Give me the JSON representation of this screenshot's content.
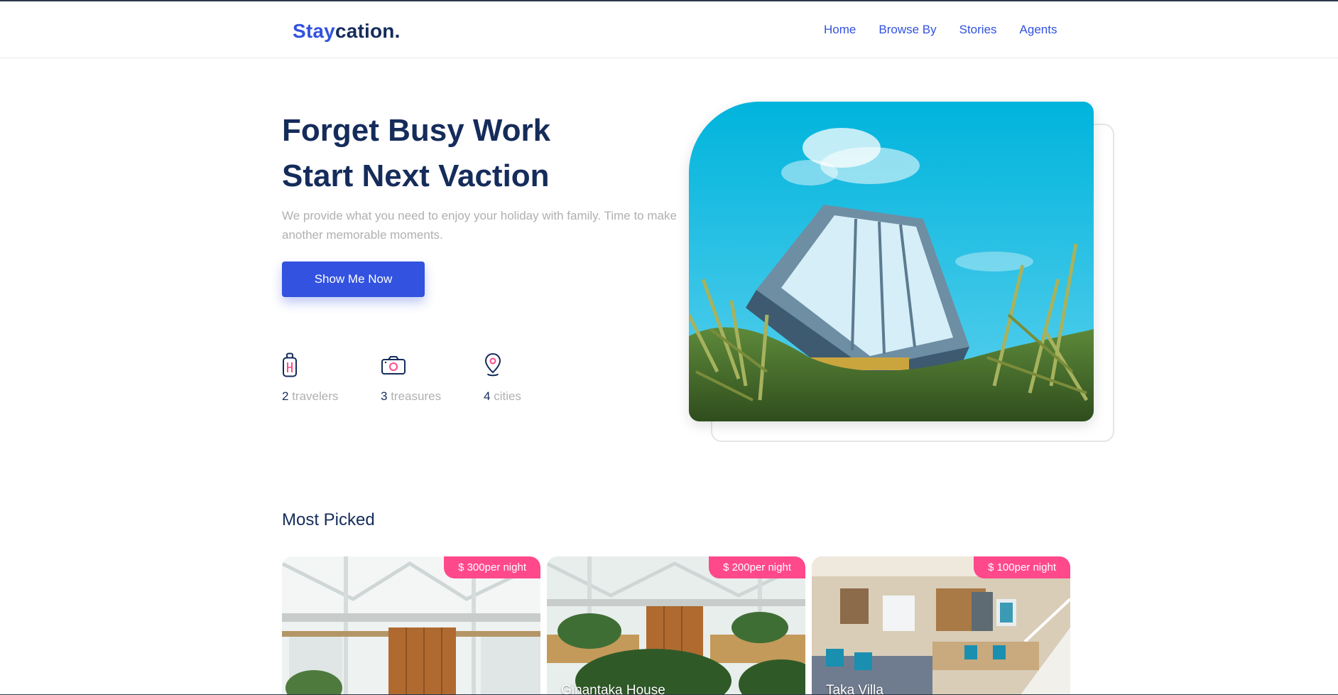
{
  "brand": {
    "part1": "Stay",
    "part2": "cation."
  },
  "nav": {
    "items": [
      {
        "label": "Home"
      },
      {
        "label": "Browse By"
      },
      {
        "label": "Stories"
      },
      {
        "label": "Agents"
      }
    ]
  },
  "hero": {
    "title_line1": "Forget Busy Work",
    "title_line2": "Start Next Vaction",
    "description": "We provide what you need to enjoy your holiday with family. Time to make another memorable moments.",
    "cta_label": "Show Me Now",
    "stats": [
      {
        "icon": "suitcase-icon",
        "value": "2",
        "label": "travelers"
      },
      {
        "icon": "camera-icon",
        "value": "3",
        "label": "treasures"
      },
      {
        "icon": "map-pin-icon",
        "value": "4",
        "label": "cities"
      }
    ]
  },
  "most_picked": {
    "title": "Most Picked",
    "cards": [
      {
        "price": "$ 300per night",
        "name": ""
      },
      {
        "price": "$ 200per night",
        "name": "Ginantaka House"
      },
      {
        "price": "$ 100per night",
        "name": "Taka Villa"
      }
    ]
  },
  "colors": {
    "primary": "#3252df",
    "heading": "#152c5b",
    "muted": "#b0b0b0",
    "price_tag": "#ff498b"
  }
}
